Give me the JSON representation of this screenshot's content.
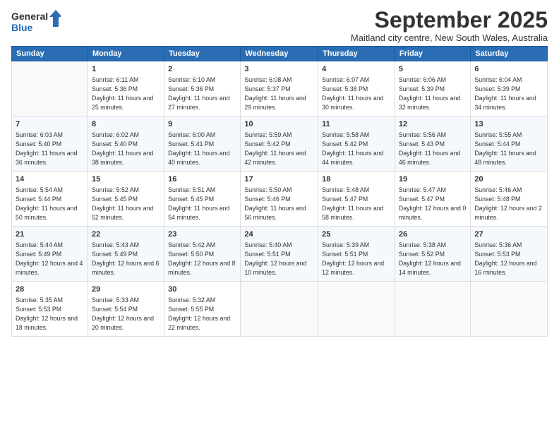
{
  "header": {
    "logo_line1": "General",
    "logo_line2": "Blue",
    "month_title": "September 2025",
    "subtitle": "Maitland city centre, New South Wales, Australia"
  },
  "days_of_week": [
    "Sunday",
    "Monday",
    "Tuesday",
    "Wednesday",
    "Thursday",
    "Friday",
    "Saturday"
  ],
  "weeks": [
    [
      {
        "day": "",
        "sunrise": "",
        "sunset": "",
        "daylight": ""
      },
      {
        "day": "1",
        "sunrise": "Sunrise: 6:11 AM",
        "sunset": "Sunset: 5:36 PM",
        "daylight": "Daylight: 11 hours and 25 minutes."
      },
      {
        "day": "2",
        "sunrise": "Sunrise: 6:10 AM",
        "sunset": "Sunset: 5:36 PM",
        "daylight": "Daylight: 11 hours and 27 minutes."
      },
      {
        "day": "3",
        "sunrise": "Sunrise: 6:08 AM",
        "sunset": "Sunset: 5:37 PM",
        "daylight": "Daylight: 11 hours and 29 minutes."
      },
      {
        "day": "4",
        "sunrise": "Sunrise: 6:07 AM",
        "sunset": "Sunset: 5:38 PM",
        "daylight": "Daylight: 11 hours and 30 minutes."
      },
      {
        "day": "5",
        "sunrise": "Sunrise: 6:06 AM",
        "sunset": "Sunset: 5:39 PM",
        "daylight": "Daylight: 11 hours and 32 minutes."
      },
      {
        "day": "6",
        "sunrise": "Sunrise: 6:04 AM",
        "sunset": "Sunset: 5:39 PM",
        "daylight": "Daylight: 11 hours and 34 minutes."
      }
    ],
    [
      {
        "day": "7",
        "sunrise": "Sunrise: 6:03 AM",
        "sunset": "Sunset: 5:40 PM",
        "daylight": "Daylight: 11 hours and 36 minutes."
      },
      {
        "day": "8",
        "sunrise": "Sunrise: 6:02 AM",
        "sunset": "Sunset: 5:40 PM",
        "daylight": "Daylight: 11 hours and 38 minutes."
      },
      {
        "day": "9",
        "sunrise": "Sunrise: 6:00 AM",
        "sunset": "Sunset: 5:41 PM",
        "daylight": "Daylight: 11 hours and 40 minutes."
      },
      {
        "day": "10",
        "sunrise": "Sunrise: 5:59 AM",
        "sunset": "Sunset: 5:42 PM",
        "daylight": "Daylight: 11 hours and 42 minutes."
      },
      {
        "day": "11",
        "sunrise": "Sunrise: 5:58 AM",
        "sunset": "Sunset: 5:42 PM",
        "daylight": "Daylight: 11 hours and 44 minutes."
      },
      {
        "day": "12",
        "sunrise": "Sunrise: 5:56 AM",
        "sunset": "Sunset: 5:43 PM",
        "daylight": "Daylight: 11 hours and 46 minutes."
      },
      {
        "day": "13",
        "sunrise": "Sunrise: 5:55 AM",
        "sunset": "Sunset: 5:44 PM",
        "daylight": "Daylight: 11 hours and 48 minutes."
      }
    ],
    [
      {
        "day": "14",
        "sunrise": "Sunrise: 5:54 AM",
        "sunset": "Sunset: 5:44 PM",
        "daylight": "Daylight: 11 hours and 50 minutes."
      },
      {
        "day": "15",
        "sunrise": "Sunrise: 5:52 AM",
        "sunset": "Sunset: 5:45 PM",
        "daylight": "Daylight: 11 hours and 52 minutes."
      },
      {
        "day": "16",
        "sunrise": "Sunrise: 5:51 AM",
        "sunset": "Sunset: 5:45 PM",
        "daylight": "Daylight: 11 hours and 54 minutes."
      },
      {
        "day": "17",
        "sunrise": "Sunrise: 5:50 AM",
        "sunset": "Sunset: 5:46 PM",
        "daylight": "Daylight: 11 hours and 56 minutes."
      },
      {
        "day": "18",
        "sunrise": "Sunrise: 5:48 AM",
        "sunset": "Sunset: 5:47 PM",
        "daylight": "Daylight: 11 hours and 58 minutes."
      },
      {
        "day": "19",
        "sunrise": "Sunrise: 5:47 AM",
        "sunset": "Sunset: 5:47 PM",
        "daylight": "Daylight: 12 hours and 0 minutes."
      },
      {
        "day": "20",
        "sunrise": "Sunrise: 5:46 AM",
        "sunset": "Sunset: 5:48 PM",
        "daylight": "Daylight: 12 hours and 2 minutes."
      }
    ],
    [
      {
        "day": "21",
        "sunrise": "Sunrise: 5:44 AM",
        "sunset": "Sunset: 5:49 PM",
        "daylight": "Daylight: 12 hours and 4 minutes."
      },
      {
        "day": "22",
        "sunrise": "Sunrise: 5:43 AM",
        "sunset": "Sunset: 5:49 PM",
        "daylight": "Daylight: 12 hours and 6 minutes."
      },
      {
        "day": "23",
        "sunrise": "Sunrise: 5:42 AM",
        "sunset": "Sunset: 5:50 PM",
        "daylight": "Daylight: 12 hours and 8 minutes."
      },
      {
        "day": "24",
        "sunrise": "Sunrise: 5:40 AM",
        "sunset": "Sunset: 5:51 PM",
        "daylight": "Daylight: 12 hours and 10 minutes."
      },
      {
        "day": "25",
        "sunrise": "Sunrise: 5:39 AM",
        "sunset": "Sunset: 5:51 PM",
        "daylight": "Daylight: 12 hours and 12 minutes."
      },
      {
        "day": "26",
        "sunrise": "Sunrise: 5:38 AM",
        "sunset": "Sunset: 5:52 PM",
        "daylight": "Daylight: 12 hours and 14 minutes."
      },
      {
        "day": "27",
        "sunrise": "Sunrise: 5:36 AM",
        "sunset": "Sunset: 5:53 PM",
        "daylight": "Daylight: 12 hours and 16 minutes."
      }
    ],
    [
      {
        "day": "28",
        "sunrise": "Sunrise: 5:35 AM",
        "sunset": "Sunset: 5:53 PM",
        "daylight": "Daylight: 12 hours and 18 minutes."
      },
      {
        "day": "29",
        "sunrise": "Sunrise: 5:33 AM",
        "sunset": "Sunset: 5:54 PM",
        "daylight": "Daylight: 12 hours and 20 minutes."
      },
      {
        "day": "30",
        "sunrise": "Sunrise: 5:32 AM",
        "sunset": "Sunset: 5:55 PM",
        "daylight": "Daylight: 12 hours and 22 minutes."
      },
      {
        "day": "",
        "sunrise": "",
        "sunset": "",
        "daylight": ""
      },
      {
        "day": "",
        "sunrise": "",
        "sunset": "",
        "daylight": ""
      },
      {
        "day": "",
        "sunrise": "",
        "sunset": "",
        "daylight": ""
      },
      {
        "day": "",
        "sunrise": "",
        "sunset": "",
        "daylight": ""
      }
    ]
  ]
}
